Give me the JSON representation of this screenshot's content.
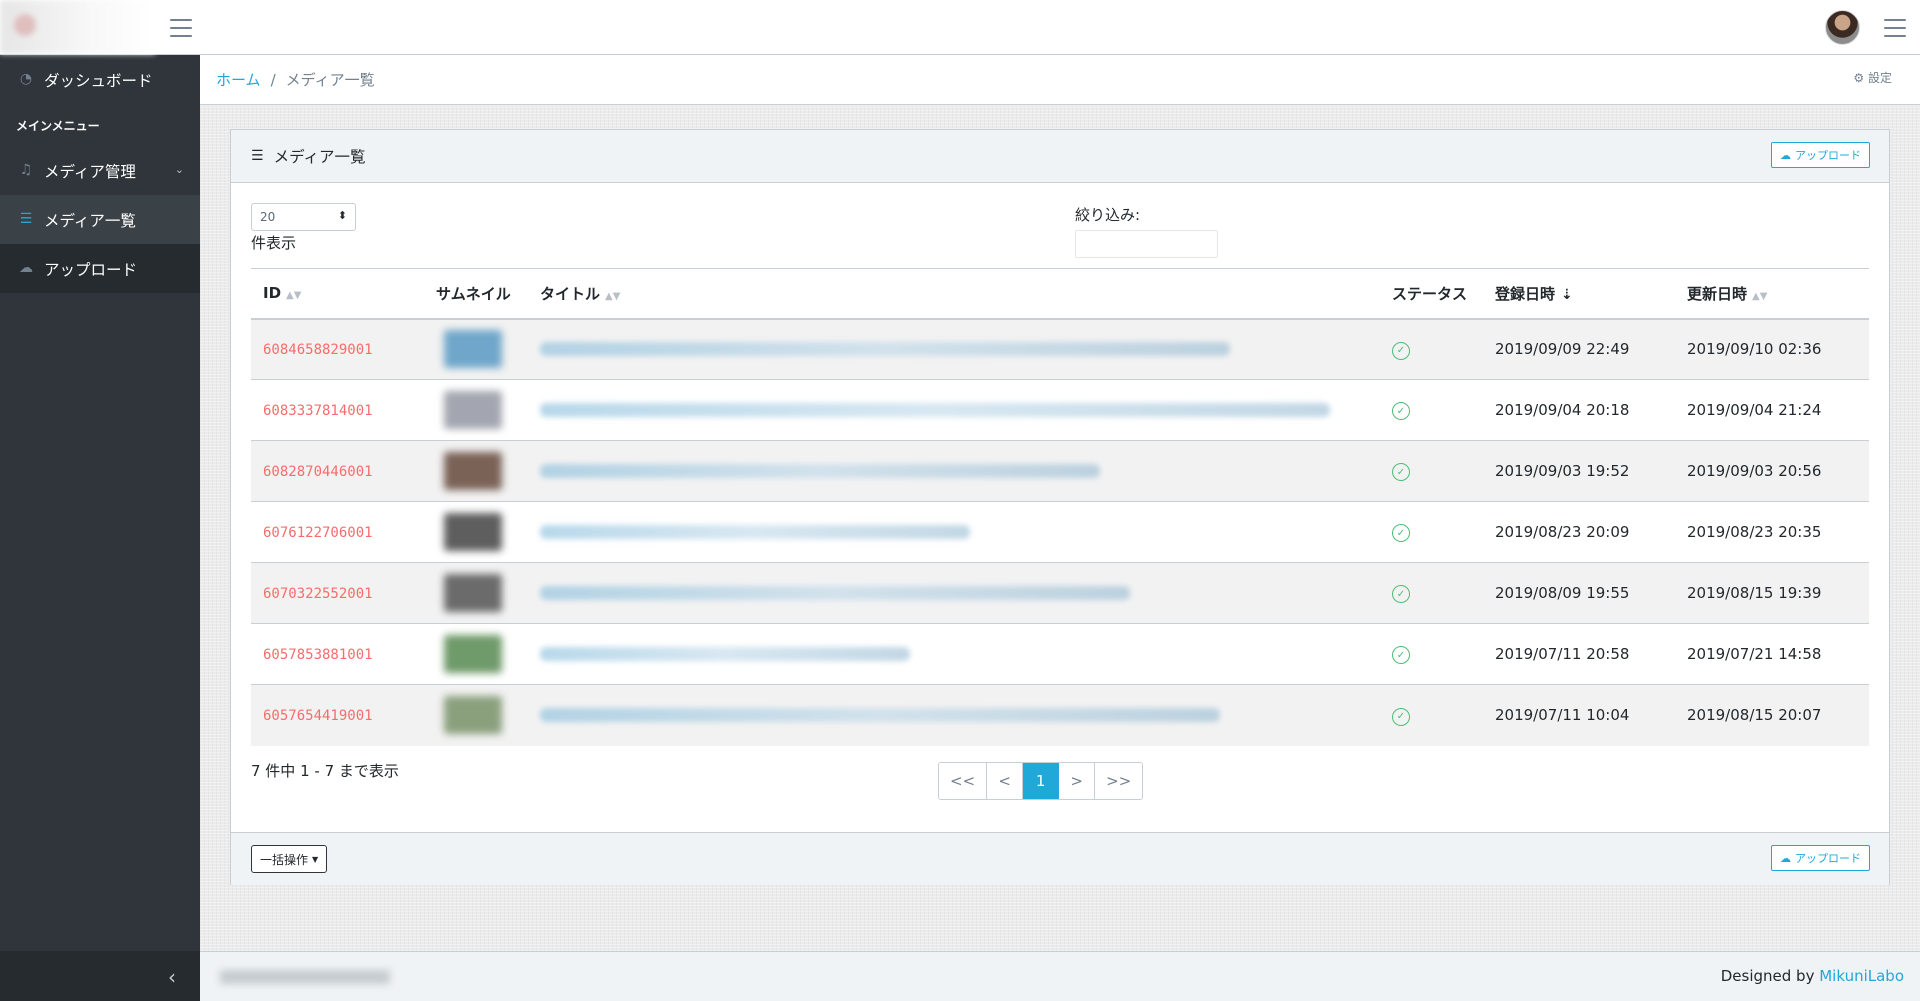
{
  "header": {
    "avatar_alt": "user avatar"
  },
  "sidebar": {
    "dashboard": "ダッシュボード",
    "section_title": "メインメニュー",
    "media_manage": "メディア管理",
    "media_list": "メディア一覧",
    "upload": "アップロード"
  },
  "breadcrumb": {
    "home": "ホーム",
    "separator": "/",
    "current": "メディア一覧",
    "settings": "設定"
  },
  "card": {
    "title": "メディア一覧",
    "upload_btn": "アップロード",
    "page_length": "20",
    "page_length_label": "件表示",
    "filter_label": "絞り込み:",
    "filter_value": "",
    "columns": [
      "ID",
      "サムネイル",
      "タイトル",
      "ステータス",
      "登録日時",
      "更新日時"
    ],
    "rows": [
      {
        "id": "6084658829001",
        "created": "2019/09/09 22:49",
        "updated": "2019/09/10 02:36",
        "thumb_color": "#6fa6c9"
      },
      {
        "id": "6083337814001",
        "created": "2019/09/04 20:18",
        "updated": "2019/09/04 21:24",
        "thumb_color": "#a3a6b0"
      },
      {
        "id": "6082870446001",
        "created": "2019/09/03 19:52",
        "updated": "2019/09/03 20:56",
        "thumb_color": "#7a6257"
      },
      {
        "id": "6076122706001",
        "created": "2019/08/23 20:09",
        "updated": "2019/08/23 20:35",
        "thumb_color": "#5e5e5e"
      },
      {
        "id": "6070322552001",
        "created": "2019/08/09 19:55",
        "updated": "2019/08/15 19:39",
        "thumb_color": "#6b6b6b"
      },
      {
        "id": "6057853881001",
        "created": "2019/07/11 20:58",
        "updated": "2019/07/21 14:58",
        "thumb_color": "#6f9a6a"
      },
      {
        "id": "6057654419001",
        "created": "2019/07/11 10:04",
        "updated": "2019/08/15 20:07",
        "thumb_color": "#8aa07c"
      }
    ],
    "summary": "7 件中 1 - 7 まで表示",
    "pager": [
      "<<",
      "<",
      "1",
      ">",
      ">>"
    ],
    "current_page": "1",
    "bulk_action": "一括操作"
  },
  "footer": {
    "designed_by": "Designed by",
    "designer": "MikuniLabo"
  },
  "colors": {
    "accent": "#20a8d8",
    "id_link": "#f86c6b",
    "status_ok": "#4dbd74",
    "sidebar_bg": "#2f353a"
  }
}
